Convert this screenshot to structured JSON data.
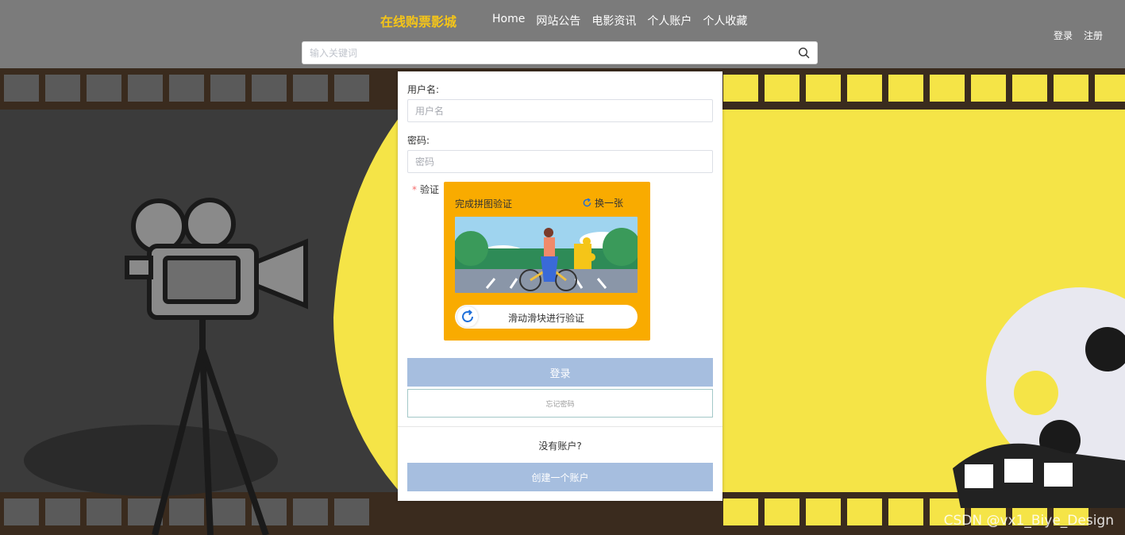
{
  "header": {
    "brand": "在线购票影城",
    "nav": [
      "Home",
      "网站公告",
      "电影资讯",
      "个人账户",
      "个人收藏"
    ],
    "auth": {
      "login": "登录",
      "register": "注册"
    },
    "search": {
      "placeholder": "输入关键词",
      "value": ""
    }
  },
  "form": {
    "username_label": "用户名:",
    "username_placeholder": "用户名",
    "password_label": "密码:",
    "password_placeholder": "密码",
    "verify_label": "验证",
    "captcha": {
      "title": "完成拼图验证",
      "refresh": "换一张",
      "slider_text": "滑动滑块进行验证"
    },
    "login_button": "登录",
    "forgot_button": "忘记密码",
    "no_account_text": "没有账户?",
    "create_button": "创建一个账户"
  },
  "watermark": "CSDN @vx1_Biye_Design",
  "colors": {
    "header_bg": "#7b7b7b",
    "brand": "#f5c518",
    "captcha_bg": "#f9ab00",
    "button_bg": "#a6bedf",
    "scene_yellow": "#f5e447"
  }
}
